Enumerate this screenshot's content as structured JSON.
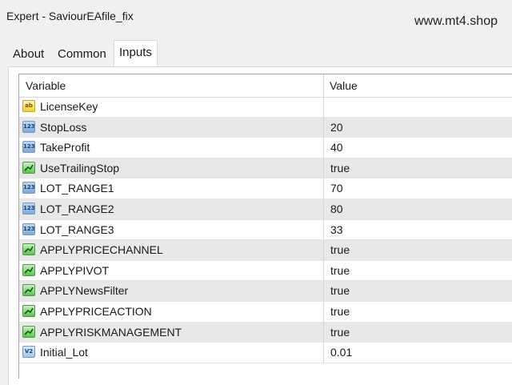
{
  "window": {
    "title": "Expert - SaviourEAfile_fix",
    "watermark": "www.mt4.shop"
  },
  "tabs": [
    {
      "label": "About",
      "active": false
    },
    {
      "label": "Common",
      "active": false
    },
    {
      "label": "Inputs",
      "active": true
    }
  ],
  "table": {
    "columns": {
      "variable": "Variable",
      "value": "Value"
    },
    "rows": [
      {
        "icon": "string-type-icon",
        "icon_text": "ab",
        "name": "LicenseKey",
        "value": ""
      },
      {
        "icon": "integer-type-icon",
        "icon_text": "123",
        "name": "StopLoss",
        "value": "20"
      },
      {
        "icon": "integer-type-icon",
        "icon_text": "123",
        "name": "TakeProfit",
        "value": "40"
      },
      {
        "icon": "boolean-type-icon",
        "icon_text": "",
        "name": "UseTrailingStop",
        "value": "true"
      },
      {
        "icon": "integer-type-icon",
        "icon_text": "123",
        "name": "LOT_RANGE1",
        "value": "70"
      },
      {
        "icon": "integer-type-icon",
        "icon_text": "123",
        "name": "LOT_RANGE2",
        "value": "80"
      },
      {
        "icon": "integer-type-icon",
        "icon_text": "123",
        "name": "LOT_RANGE3",
        "value": "33"
      },
      {
        "icon": "boolean-type-icon",
        "icon_text": "",
        "name": "APPLYPRICECHANNEL",
        "value": "true"
      },
      {
        "icon": "boolean-type-icon",
        "icon_text": "",
        "name": "APPLYPIVOT",
        "value": "true"
      },
      {
        "icon": "boolean-type-icon",
        "icon_text": "",
        "name": "APPLYNewsFilter",
        "value": "true"
      },
      {
        "icon": "boolean-type-icon",
        "icon_text": "",
        "name": "APPLYPRICEACTION",
        "value": "true"
      },
      {
        "icon": "boolean-type-icon",
        "icon_text": "",
        "name": "APPLYRISKMANAGEMENT",
        "value": "true"
      },
      {
        "icon": "double-type-icon",
        "icon_text": "V2",
        "name": "Initial_Lot",
        "value": "0.01"
      }
    ]
  }
}
